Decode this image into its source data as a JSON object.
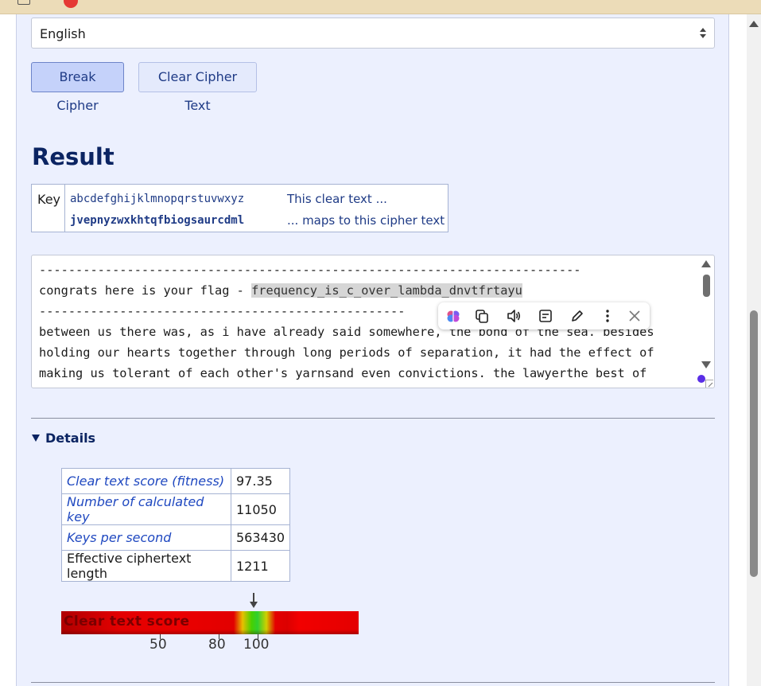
{
  "language_select": {
    "value": "English"
  },
  "buttons": {
    "break": "Break Cipher",
    "clear": "Clear Cipher Text"
  },
  "result": {
    "heading": "Result",
    "key_table": {
      "label": "Key",
      "clear_alphabet": "abcdefghijklmnopqrstuvwxyz",
      "cipher_alphabet": "jvepnyzwxkhtqfbiogsaurcdml",
      "note_clear": "This clear text ...",
      "note_cipher": "... maps to this cipher text"
    },
    "text": {
      "dashes1": "--------------------------------------------------------------------------",
      "flag_prefix": "congrats here is your flag - ",
      "flag": "frequency_is_c_over_lambda_dnvtfrtayu",
      "dashes2": "--------------------------------------------------",
      "line3": "between us there was, as i have already said somewhere, the bond of the sea. besides",
      "line4": "holding our hearts together through long periods of separation, it had the effect of",
      "line5": "making us tolerant of each other's yarnsand even convictions. the lawyerthe best of"
    }
  },
  "floating_toolbar": {
    "icons": [
      "brain-icon",
      "copy-icon",
      "speaker-icon",
      "summarize-icon",
      "pencil-icon",
      "more-vertical-icon",
      "close-icon"
    ]
  },
  "details": {
    "summary": "Details",
    "stats": [
      {
        "label": "Clear text score (fitness)",
        "value": "97.35"
      },
      {
        "label": "Number of calculated key",
        "value": "11050"
      },
      {
        "label": "Keys per second",
        "value": "563430"
      },
      {
        "label": "Effective ciphertext length",
        "value": "1211"
      }
    ],
    "gauge": {
      "label": "Clear text score",
      "ticks": [
        "50",
        "80",
        "100"
      ],
      "pointer_value": 97.35
    }
  },
  "colors": {
    "accent": "#0b2462",
    "link": "#1f48c0",
    "panel_bg": "#ecf0fe"
  }
}
